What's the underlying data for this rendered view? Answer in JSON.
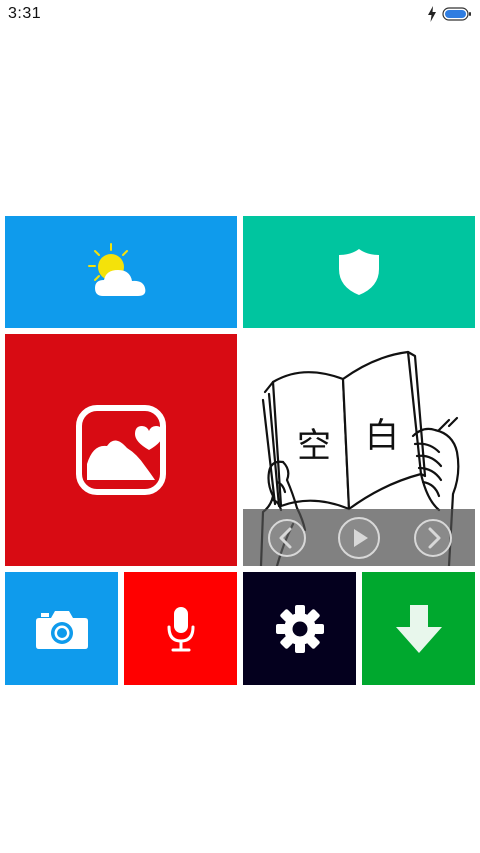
{
  "status_bar": {
    "time": "3:31",
    "icons": [
      "charging-bolt-icon",
      "battery-icon"
    ],
    "battery_color": "#2f7de1"
  },
  "tiles": [
    {
      "name": "weather",
      "icon": "sun-cloud-icon",
      "color": "#0f9bec"
    },
    {
      "name": "security",
      "icon": "shield-icon",
      "color": "#00c59f"
    },
    {
      "name": "gallery",
      "icon": "photo-heart-icon",
      "color": "#d80b13"
    },
    {
      "name": "media-player",
      "icon": "book-illustration",
      "book_text": [
        "空",
        "白"
      ]
    },
    {
      "name": "camera",
      "icon": "camera-icon",
      "color": "#0f9bec"
    },
    {
      "name": "voice",
      "icon": "microphone-icon",
      "color": "#ff0000"
    },
    {
      "name": "settings",
      "icon": "gear-icon",
      "color": "#04001e"
    },
    {
      "name": "download",
      "icon": "download-arrow-icon",
      "color": "#00a82e"
    }
  ],
  "media_controls": [
    "previous-icon",
    "play-icon",
    "next-icon"
  ]
}
